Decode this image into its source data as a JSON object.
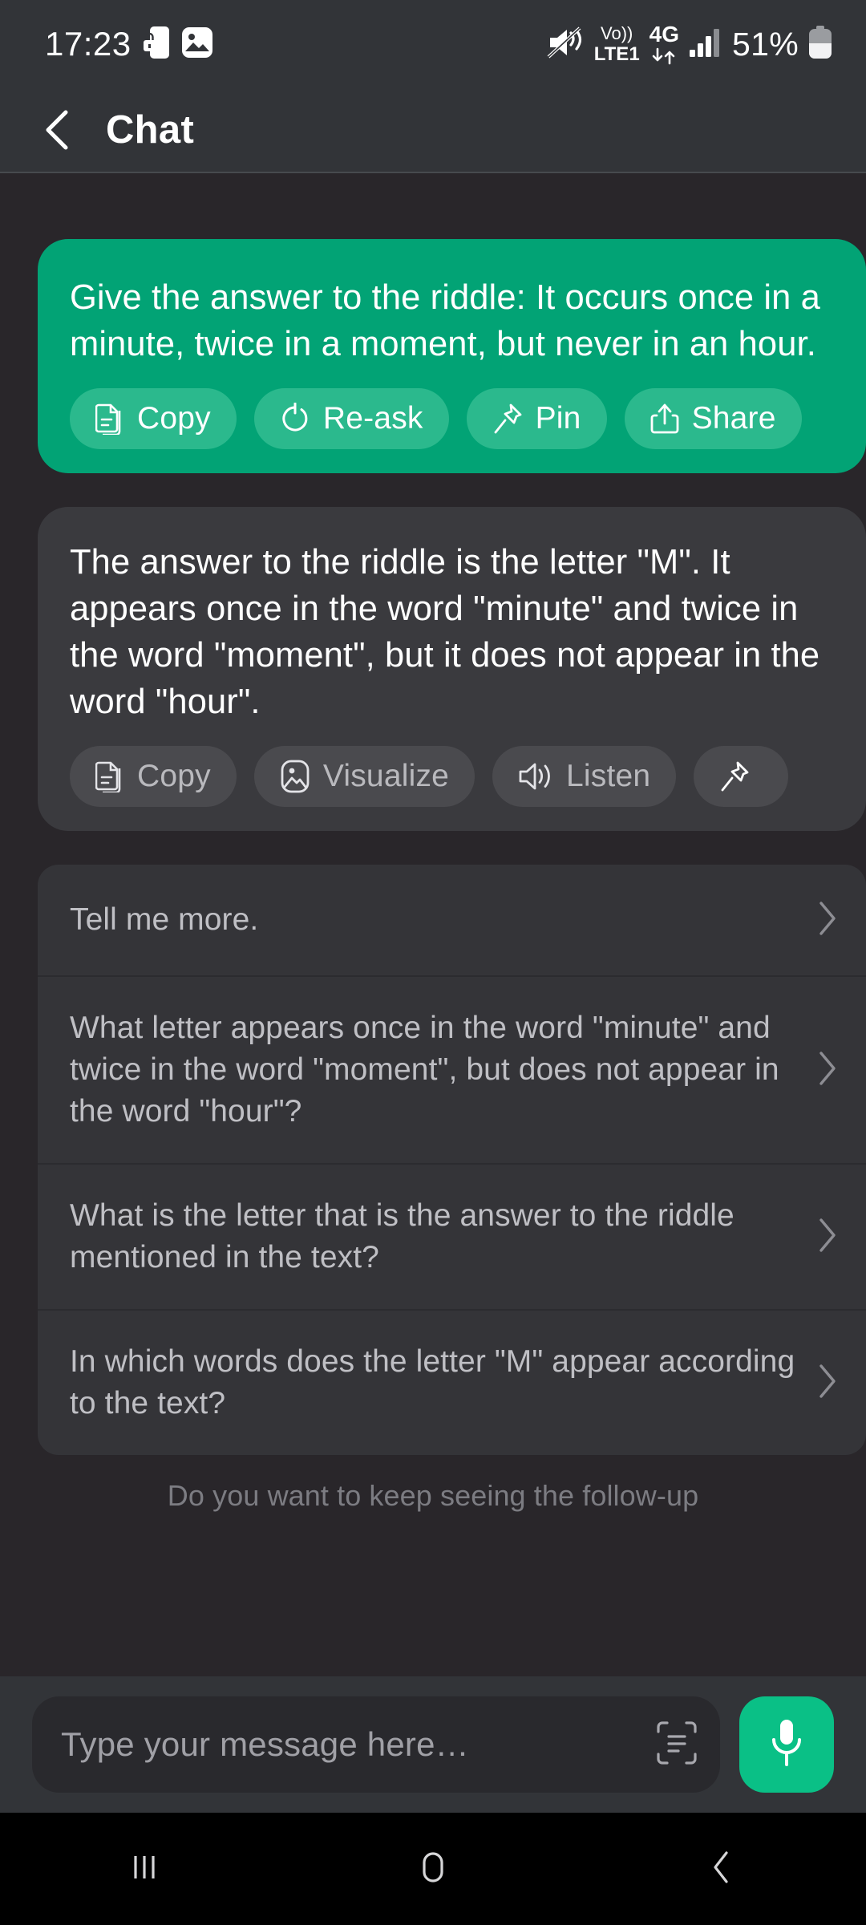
{
  "status_bar": {
    "time": "17:23",
    "left_icons": [
      "phone-lock-icon",
      "gallery-image-icon"
    ],
    "right_icons": [
      "mute-vibrate-icon",
      "volte-icon",
      "4g-data-icon",
      "signal-bars-icon"
    ],
    "volte_label_top": "Vo))",
    "volte_label_bottom": "LTE1",
    "network_label": "4G",
    "battery_percent": "51%"
  },
  "header": {
    "back_label": "back",
    "title": "Chat"
  },
  "messages": [
    {
      "role": "user",
      "text": "Give the answer to the riddle: It occurs once in a minute, twice in a moment, but never in an hour.",
      "actions": [
        {
          "icon": "copy-document-icon",
          "label": "Copy"
        },
        {
          "icon": "refresh-icon",
          "label": "Re-ask"
        },
        {
          "icon": "pin-icon",
          "label": "Pin"
        },
        {
          "icon": "share-upload-icon",
          "label": "Share"
        }
      ]
    },
    {
      "role": "assistant",
      "text": "The answer to the riddle is the letter \"M\". It appears once in the word \"minute\" and twice in the word \"moment\", but it does not appear in the word \"hour\".",
      "actions": [
        {
          "icon": "copy-document-icon",
          "label": "Copy"
        },
        {
          "icon": "image-picture-icon",
          "label": "Visualize"
        },
        {
          "icon": "speaker-sound-icon",
          "label": "Listen"
        },
        {
          "icon": "pin-icon",
          "label": ""
        }
      ]
    }
  ],
  "suggestions": [
    {
      "text": "Tell me more."
    },
    {
      "text": "What letter appears once in the word \"minute\" and twice in the word \"moment\", but does not appear in the word \"hour\"?"
    },
    {
      "text": "What is the letter that is the answer to the riddle mentioned in the text?"
    },
    {
      "text": "In which words does the letter \"M\" appear according to the text?"
    }
  ],
  "followup_note": "Do you want to keep seeing the follow-up",
  "input_bar": {
    "placeholder": "Type your message here…",
    "scan_icon": "scan-text-icon",
    "mic_icon": "microphone-icon"
  },
  "nav_bar": {
    "recents_label": "recents",
    "home_label": "home",
    "back_label": "back"
  },
  "colors": {
    "user_bubble": "#02a375",
    "user_chip": "#2bb98d",
    "ai_bubble": "#3a3a3e",
    "ai_chip": "#4a4a4e",
    "page_bg": "#29262a",
    "bar_bg": "#323438",
    "mic_green": "#0ac086"
  }
}
